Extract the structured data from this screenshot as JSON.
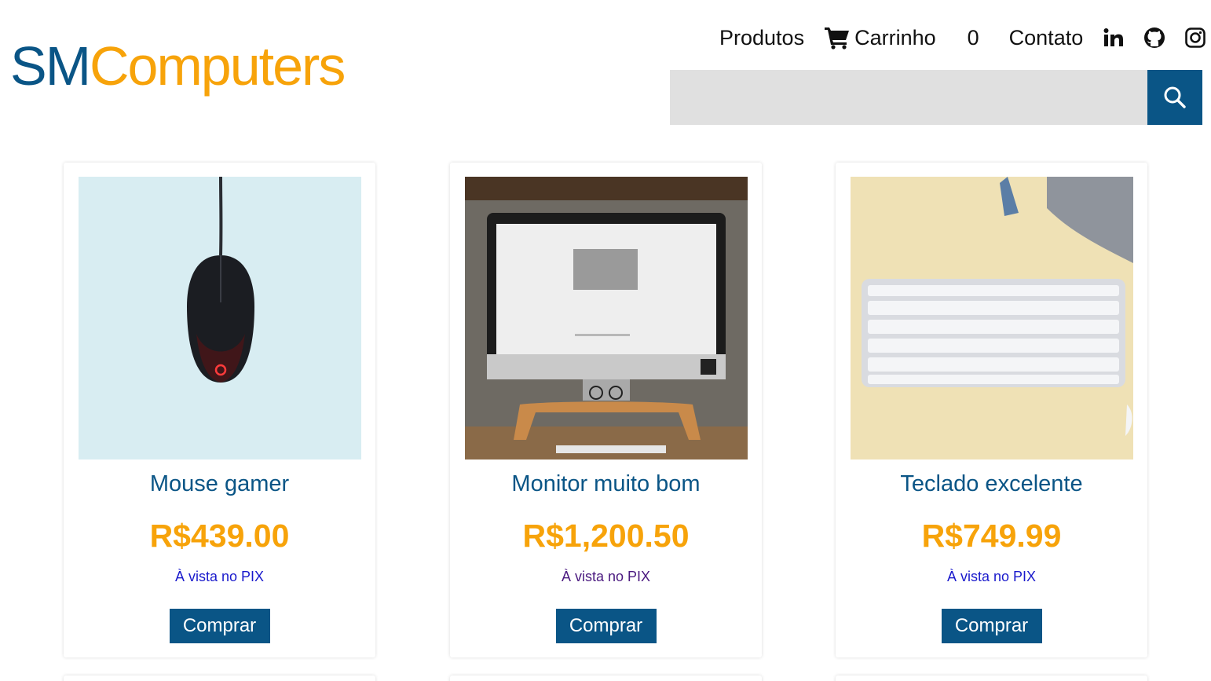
{
  "brand": {
    "part1": "SM",
    "part2": "Computers",
    "color_primary": "#0a5586",
    "color_accent": "#f7a30a"
  },
  "nav": {
    "produtos": "Produtos",
    "carrinho": "Carrinho",
    "cart_count": "0",
    "contato": "Contato",
    "cart_icon": "shopping-cart-icon",
    "social_icons": [
      "linkedin-icon",
      "github-icon",
      "instagram-icon"
    ]
  },
  "search": {
    "placeholder": "",
    "value": "",
    "button_icon": "search-icon"
  },
  "products": [
    {
      "name": "Mouse gamer",
      "price": "R$439.00",
      "payment_note": "À vista no PIX",
      "buy_label": "Comprar"
    },
    {
      "name": "Monitor muito bom",
      "price": "R$1,200.50",
      "payment_note": "À vista no PIX",
      "buy_label": "Comprar"
    },
    {
      "name": "Teclado excelente",
      "price": "R$749.99",
      "payment_note": "À vista no PIX",
      "buy_label": "Comprar"
    }
  ]
}
